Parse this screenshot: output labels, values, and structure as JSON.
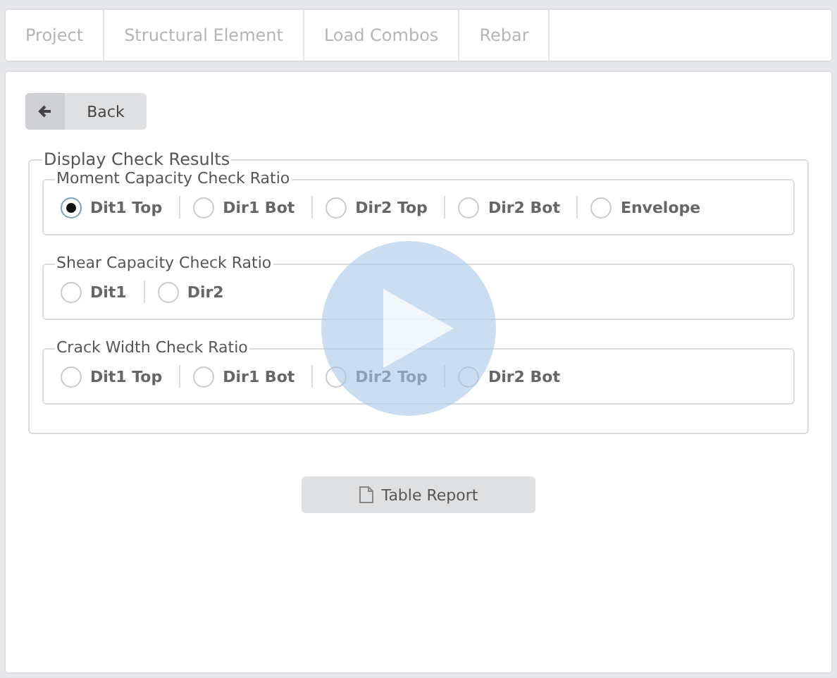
{
  "tabs": [
    {
      "label": "Project",
      "selected": false
    },
    {
      "label": "Structural Element",
      "selected": false
    },
    {
      "label": "Load Combos",
      "selected": false
    },
    {
      "label": "Rebar",
      "selected": false
    }
  ],
  "back_button": {
    "label": "Back"
  },
  "display_check_results": {
    "title": "Display Check Results",
    "groups": [
      {
        "title": "Moment Capacity Check Ratio",
        "options": [
          {
            "label": "Dit1 Top",
            "selected": true
          },
          {
            "label": "Dir1 Bot",
            "selected": false
          },
          {
            "label": "Dir2 Top",
            "selected": false
          },
          {
            "label": "Dir2 Bot",
            "selected": false
          },
          {
            "label": "Envelope",
            "selected": false
          }
        ]
      },
      {
        "title": "Shear Capacity Check Ratio",
        "options": [
          {
            "label": "Dit1",
            "selected": false
          },
          {
            "label": "Dir2",
            "selected": false
          }
        ]
      },
      {
        "title": "Crack Width Check Ratio",
        "options": [
          {
            "label": "Dit1 Top",
            "selected": false
          },
          {
            "label": "Dir1 Bot",
            "selected": false
          },
          {
            "label": "Dir2 Top",
            "selected": false
          },
          {
            "label": "Dir2 Bot",
            "selected": false
          }
        ]
      }
    ]
  },
  "table_report_button": {
    "label": "Table Report"
  }
}
